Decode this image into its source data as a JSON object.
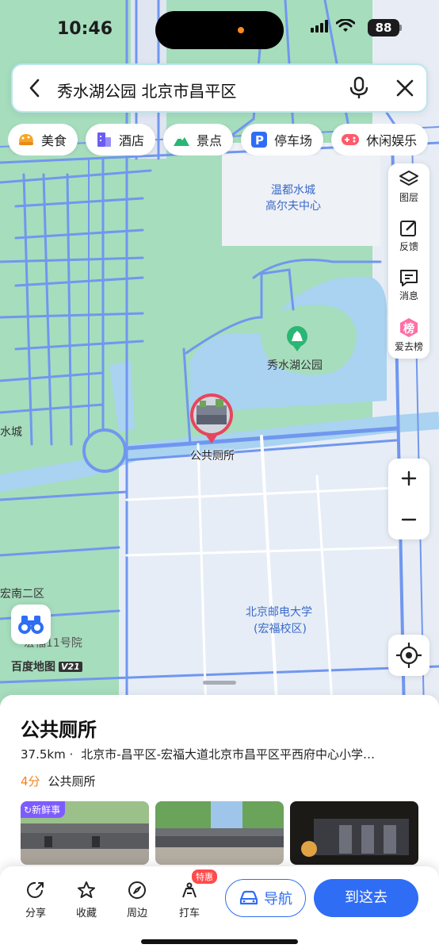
{
  "status_bar": {
    "time": "10:46",
    "battery": "88"
  },
  "search": {
    "query": "秀水湖公园 北京市昌平区"
  },
  "categories": [
    {
      "label": "美食",
      "icon": "food-icon",
      "color": "#f5a623"
    },
    {
      "label": "酒店",
      "icon": "hotel-icon",
      "color": "#6b5cf2"
    },
    {
      "label": "景点",
      "icon": "scenic-icon",
      "color": "#2ab673"
    },
    {
      "label": "停车场",
      "icon": "parking-icon",
      "color": "#2f6df5"
    },
    {
      "label": "休闲娱乐",
      "icon": "gamepad-icon",
      "color": "#ff5a6a"
    }
  ],
  "tools": {
    "layers": "图层",
    "feedback": "反馈",
    "messages": "消息",
    "ranking": "爱去榜",
    "ranking_glyph": "榜"
  },
  "map": {
    "labels": {
      "golf": [
        "温都水城",
        "高尔夫中心"
      ],
      "park": "秀水湖公园",
      "water_city": "水城",
      "district": "宏南二区",
      "hongfu": "宏福11号院",
      "university": [
        "北京邮电大学",
        "(宏福校区)"
      ]
    },
    "marker_label": "公共厕所",
    "logo_text": "百度地图",
    "logo_version": "V21",
    "colors": {
      "park": "#a6ddbd",
      "water": "#a9d3f0",
      "road": "#6f95f0",
      "campus": "#e6edf7"
    }
  },
  "place": {
    "title": "公共厕所",
    "distance": "37.5km ·",
    "address": "北京市-昌平区-宏福大道北京市昌平区平西府中心小学…",
    "rating": "4分",
    "category": "公共厕所",
    "photo_badge": "新鲜事"
  },
  "actions": {
    "share": "分享",
    "favorite": "收藏",
    "nearby": "周边",
    "taxi": "打车",
    "taxi_promo": "特惠",
    "navigate": "导航",
    "go_here": "到这去"
  },
  "accent": "#2f6df5"
}
